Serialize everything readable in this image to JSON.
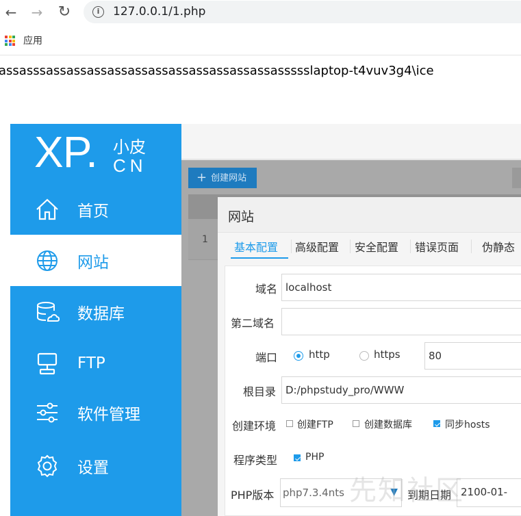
{
  "browser": {
    "back_glyph": "←",
    "forward_glyph": "→",
    "reload_glyph": "↻",
    "info_glyph": "i",
    "url": "127.0.0.1/1.php",
    "bookmarks_apps_label": "应用"
  },
  "page": {
    "output_text": "assasssassassassassassassassassassassassassssslaptop-t4vuv3g4\\ice"
  },
  "sidebar": {
    "logo_xp": "XP.",
    "logo_xiaopi": "小皮",
    "logo_cn": "CN",
    "items": [
      {
        "label": "首页",
        "icon": "home-icon"
      },
      {
        "label": "网站",
        "icon": "globe-icon"
      },
      {
        "label": "数据库",
        "icon": "database-icon"
      },
      {
        "label": "FTP",
        "icon": "ftp-icon"
      },
      {
        "label": "软件管理",
        "icon": "sliders-icon"
      },
      {
        "label": "设置",
        "icon": "gear-icon"
      }
    ],
    "active_index": 1
  },
  "main": {
    "create_button": "创建网站",
    "row_number": "1"
  },
  "modal": {
    "title": "网站",
    "tabs": [
      "基本配置",
      "高级配置",
      "安全配置",
      "错误页面",
      "伪静态"
    ],
    "active_tab": 0,
    "form": {
      "domain_label": "域名",
      "domain_value": "localhost",
      "second_domain_label": "第二域名",
      "second_domain_value": "",
      "port_label": "端口",
      "http_label": "http",
      "https_label": "https",
      "port_value": "80",
      "protocol_selected": "http",
      "root_label": "根目录",
      "root_value": "D:/phpstudy_pro/WWW",
      "env_label": "创建环境",
      "env_ftp": "创建FTP",
      "env_db": "创建数据库",
      "env_hosts": "同步hosts",
      "env_ftp_checked": false,
      "env_db_checked": false,
      "env_hosts_checked": true,
      "program_label": "程序类型",
      "program_php": "PHP",
      "program_php_checked": true,
      "php_version_label": "PHP版本",
      "php_version_value": "php7.3.4nts",
      "expire_label": "到期日期",
      "expire_value": "2100-01-"
    }
  },
  "watermark": "先知社区",
  "colors": {
    "brand_blue": "#1e9bea",
    "button_blue": "#1e7bbf"
  }
}
